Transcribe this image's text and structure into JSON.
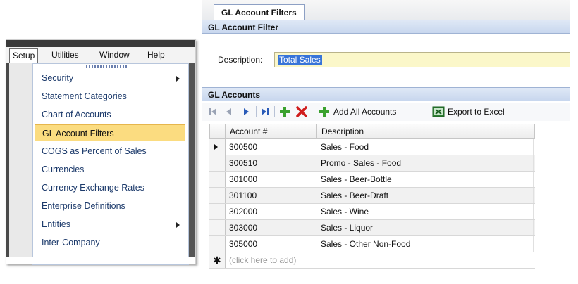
{
  "menubar": {
    "items": [
      "Setup",
      "Utilities",
      "Window",
      "Help"
    ]
  },
  "setup_menu": {
    "items": [
      {
        "label": "Security",
        "submenu": true
      },
      {
        "label": "Statement Categories",
        "submenu": false
      },
      {
        "label": "Chart of Accounts",
        "submenu": false
      },
      {
        "label": "GL Account Filters",
        "submenu": false,
        "highlighted": true
      },
      {
        "label": "COGS as Percent of Sales",
        "submenu": false
      },
      {
        "label": "Currencies",
        "submenu": false
      },
      {
        "label": "Currency Exchange Rates",
        "submenu": false
      },
      {
        "label": "Enterprise Definitions",
        "submenu": false
      },
      {
        "label": "Entities",
        "submenu": true
      },
      {
        "label": "Inter-Company",
        "submenu": false
      }
    ]
  },
  "window": {
    "tab_label": "GL Account Filters",
    "filter_section_title": "GL Account Filter",
    "description_label": "Description:",
    "description_value": "Total Sales",
    "accounts_section_title": "GL Accounts",
    "toolbar": {
      "add_all_label": "Add All Accounts",
      "export_label": "Export to Excel"
    },
    "grid": {
      "columns": [
        "Account #",
        "Description"
      ],
      "rows": [
        {
          "account": "300500",
          "description": "Sales - Food",
          "current": true
        },
        {
          "account": "300510",
          "description": "Promo - Sales - Food",
          "current": false
        },
        {
          "account": "301000",
          "description": "Sales - Beer-Bottle",
          "current": false
        },
        {
          "account": "301100",
          "description": "Sales - Beer-Draft",
          "current": false
        },
        {
          "account": "302000",
          "description": "Sales - Wine",
          "current": false
        },
        {
          "account": "303000",
          "description": "Sales - Liquor",
          "current": false
        },
        {
          "account": "305000",
          "description": "Sales - Other Non-Food",
          "current": false
        }
      ],
      "add_row_text": "(click here to add)"
    }
  },
  "colors": {
    "menu_highlight": "#fbdc80",
    "section_header": "#c8d7ee",
    "description_field": "#fbf7c9",
    "selection": "#3874d8"
  }
}
